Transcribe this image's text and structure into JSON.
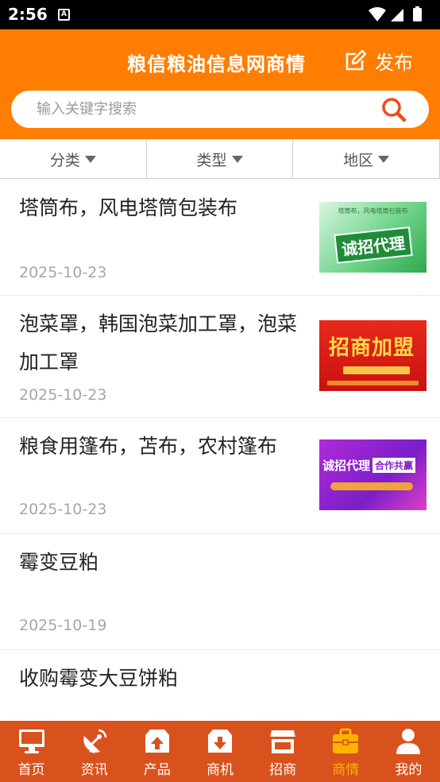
{
  "status_bar": {
    "time": "2:56",
    "notification_letter": "A"
  },
  "header": {
    "title": "粮信粮油信息网商情",
    "publish_label": "发布"
  },
  "search": {
    "placeholder": "输入关键字搜索",
    "value": ""
  },
  "filters": [
    {
      "label": "分类"
    },
    {
      "label": "类型"
    },
    {
      "label": "地区"
    }
  ],
  "items": [
    {
      "title": "塔筒布，风电塔筒包装布",
      "date": "2025-10-23",
      "thumb_text": "诚招代理",
      "thumb_caption": "塔筒布，风电塔筒包装布"
    },
    {
      "title": "泡菜罩，韩国泡菜加工罩，泡菜加工罩",
      "date": "2025-10-23",
      "thumb_text": "招商加盟"
    },
    {
      "title": "粮食用篷布，苫布，农村篷布",
      "date": "2025-10-23",
      "thumb_text": "诚招代理",
      "thumb_text2": "合作共赢"
    },
    {
      "title": "霉变豆粕",
      "date": "2025-10-19"
    },
    {
      "title": "收购霉变大豆饼粕",
      "date": ""
    }
  ],
  "tabs": [
    {
      "label": "首页",
      "icon": "monitor-icon"
    },
    {
      "label": "资讯",
      "icon": "satellite-dish-icon"
    },
    {
      "label": "产品",
      "icon": "upload-box-icon"
    },
    {
      "label": "商机",
      "icon": "download-box-icon"
    },
    {
      "label": "招商",
      "icon": "store-icon"
    },
    {
      "label": "商情",
      "icon": "briefcase-icon",
      "active": true
    },
    {
      "label": "我的",
      "icon": "user-icon"
    }
  ],
  "colors": {
    "brand_orange": "#ff7d00",
    "tabbar": "#d9521d",
    "active_tab": "#ffb300",
    "search_icon": "#f04a1a"
  }
}
